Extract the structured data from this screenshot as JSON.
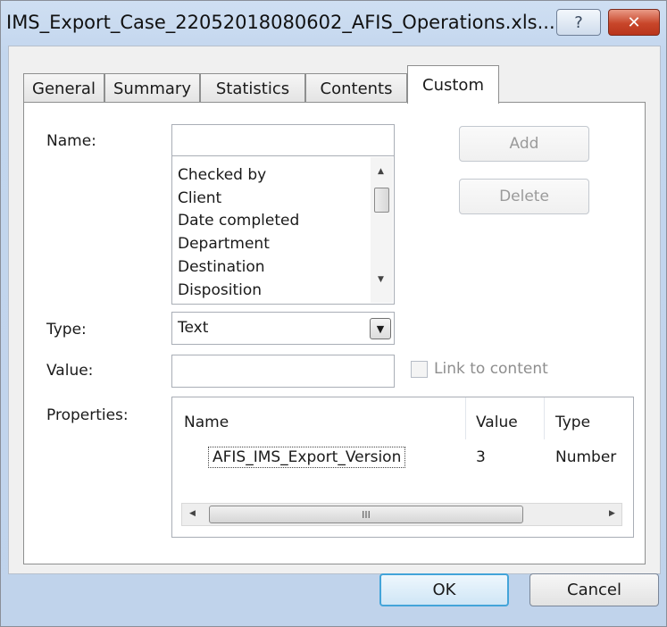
{
  "window": {
    "title": "IMS_Export_Case_22052018080602_AFIS_Operations.xls...",
    "help_glyph": "?",
    "close_glyph": "✕"
  },
  "tabs": [
    {
      "label": "General"
    },
    {
      "label": "Summary"
    },
    {
      "label": "Statistics"
    },
    {
      "label": "Contents"
    },
    {
      "label": "Custom",
      "active": true
    }
  ],
  "custom": {
    "name_label": "Name:",
    "name_value": "",
    "name_list": [
      "Checked by",
      "Client",
      "Date completed",
      "Department",
      "Destination",
      "Disposition"
    ],
    "add_label": "Add",
    "delete_label": "Delete",
    "type_label": "Type:",
    "type_value": "Text",
    "value_label": "Value:",
    "value_value": "",
    "link_to_content_label": "Link to content",
    "properties_label": "Properties:",
    "properties_table": {
      "headers": [
        "Name",
        "Value",
        "Type"
      ],
      "rows": [
        {
          "name": "AFIS_IMS_Export_Version",
          "value": "3",
          "type": "Number"
        }
      ]
    },
    "hscroll_grip": "III"
  },
  "footer": {
    "ok_label": "OK",
    "cancel_label": "Cancel"
  },
  "colors": {
    "accent": "#43a4d9",
    "close": "#c8462a",
    "titlebar": "#c3d6ee"
  },
  "icons": [
    "help-icon",
    "close-icon",
    "scroll-up-icon",
    "scroll-down-icon",
    "dropdown-arrow-icon",
    "scroll-left-icon",
    "scroll-right-icon"
  ]
}
